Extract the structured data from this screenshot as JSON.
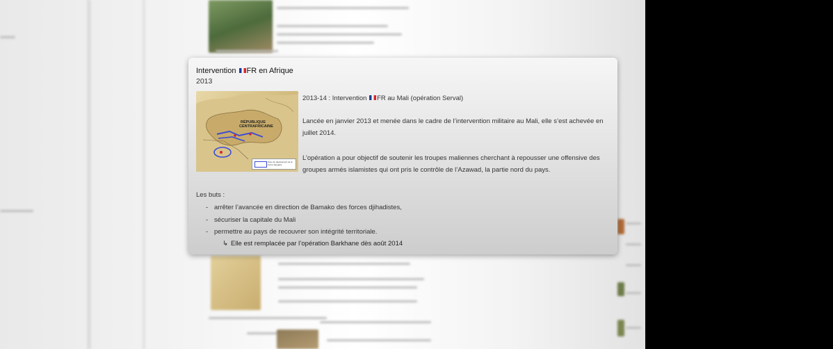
{
  "popup": {
    "title_prefix": "Intervention ",
    "title_suffix": "FR en Afrique",
    "year": "2013",
    "map": {
      "label": "RÉPUBLIQUE CENTRAFRICAINE",
      "legend_text": "Zone de déploiement de la Force Sangaris"
    },
    "section_prefix": "2013-14 : Intervention ",
    "section_suffix": "FR au Mali (opération Serval)",
    "para1": "Lancée en janvier 2013 et menée dans le cadre de l’intervention militaire au Mali, elle s’est achevée en juillet 2014.",
    "para2": "L’opération a pour objectif de soutenir les troupes maliennes cherchant à repousser une offensive des groupes armés islamistes qui ont pris le contrôle de l’Azawad, la partie nord du pays.",
    "goals_label": "Les buts :",
    "goals": [
      "arrêter l’avancée en direction de Bamako des forces djihadistes,",
      "sécuriser la capitale du Mali",
      "permettre au pays de recouvrer son intégrité territoriale."
    ],
    "sub_note": "Elle est remplacée par l’opération Barkhane dès août 2014"
  },
  "icons": {
    "flag": "flag-france-icon",
    "bullet": "dash-bullet",
    "arrow": "return-arrow-icon"
  },
  "colors": {
    "flag_blue": "#1f3c9b",
    "flag_white": "#ffffff",
    "flag_red": "#d6262b",
    "map_zone": "#3b4bd6"
  }
}
